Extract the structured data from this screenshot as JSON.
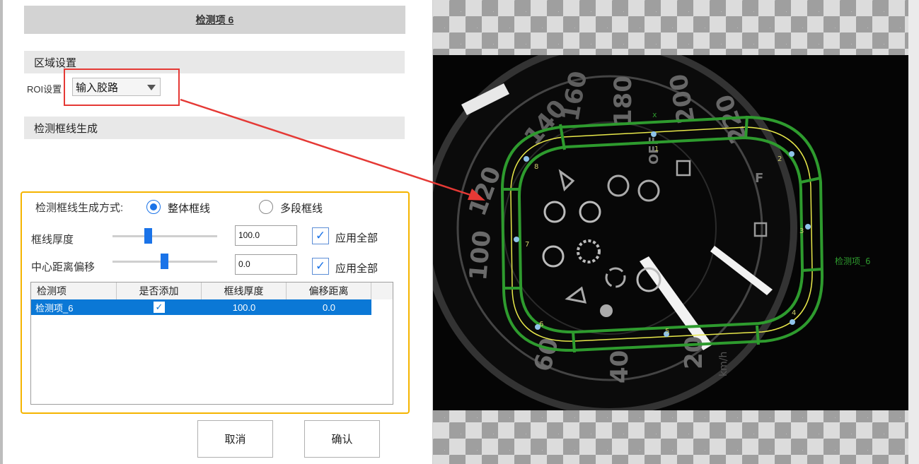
{
  "dialog": {
    "title": "检测项 6",
    "region_section": "区域设置",
    "roi_label": "ROI设置",
    "roi_value": "输入胶路",
    "frame_section": "检测框线生成"
  },
  "generation": {
    "mode_label": "检测框线生成方式:",
    "option_whole": "整体框线",
    "option_multi": "多段框线",
    "selected": "整体框线",
    "thickness_label": "框线厚度",
    "thickness_value": "100.0",
    "thickness_apply_all": "应用全部",
    "offset_label": "中心距离偏移",
    "offset_value": "0.0",
    "offset_apply_all": "应用全部"
  },
  "table": {
    "columns": [
      "检测项",
      "是否添加",
      "框线厚度",
      "偏移距离"
    ],
    "rows": [
      {
        "name": "检测项_6",
        "added": true,
        "thickness": "100.0",
        "offset": "0.0"
      }
    ]
  },
  "buttons": {
    "cancel": "取消",
    "confirm": "确认"
  },
  "preview": {
    "frame_label": "检测项_6",
    "point_labels": [
      "1",
      "2",
      "3",
      "4",
      "5",
      "6",
      "7",
      "8"
    ],
    "speed_marks": [
      "100",
      "120",
      "140",
      "160",
      "180",
      "200",
      "220",
      "20",
      "40",
      "60"
    ],
    "cross_mark": "x",
    "unit": "km/h",
    "off_text": "OFF",
    "fuel_letter": "F",
    "outline_color": "#2e9b2e",
    "path_color": "#e8e84a"
  }
}
